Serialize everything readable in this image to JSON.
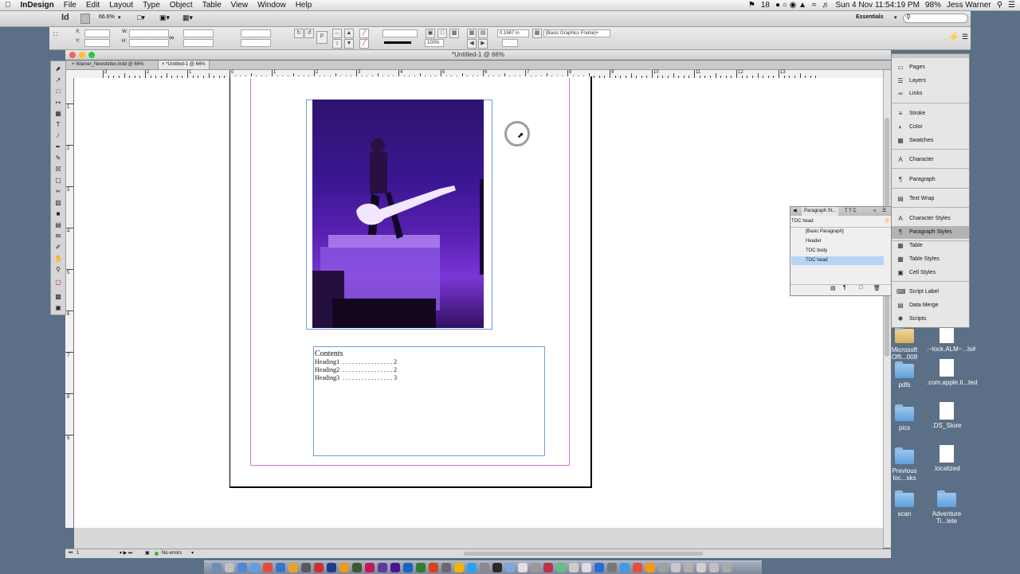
{
  "menubar": {
    "app": "InDesign",
    "items": [
      "File",
      "Edit",
      "Layout",
      "Type",
      "Object",
      "Table",
      "View",
      "Window",
      "Help"
    ],
    "right": {
      "flag_count": "18",
      "clock": "Sun 4 Nov  11:54:19 PM",
      "battery": "98%",
      "user": "Jess Warner"
    }
  },
  "appbar": {
    "logo": "Id",
    "zoom": "66.6%",
    "workspace": "Essentials",
    "search_placeholder": ""
  },
  "control": {
    "x_label": "X:",
    "y_label": "Y:",
    "w_label": "W:",
    "h_label": "H:",
    "stroke_weight": "0.1667 in",
    "scale_pct": "100%",
    "object_style": "[Basic Graphics Frame]+"
  },
  "document": {
    "window_title": "*Untitled-1 @ 66%",
    "tabs": [
      "Warner_Newsletter.indd @ 66%",
      "*Untitled-1 @ 66%"
    ]
  },
  "ruler_top_labels": [
    "3",
    "2",
    "1",
    "0",
    "1",
    "2",
    "3",
    "4",
    "5",
    "6",
    "7",
    "8",
    "9",
    "10",
    "11",
    "12",
    "13"
  ],
  "ruler_left_labels": [
    "1",
    "2",
    "3",
    "4",
    "5",
    "6",
    "7",
    "8",
    "9"
  ],
  "toc": {
    "heading": "Contents",
    "rows": [
      "Heading1  . . . . . . . . . . . . . . . . 2",
      "Heading2  . . . . . . . . . . . . . . . . 2",
      "Heading3  . . . . . . . . . . . . . . . . 3"
    ]
  },
  "status": {
    "page": "1",
    "errors": "No errors"
  },
  "panels": {
    "items": [
      {
        "label": "Pages",
        "icon": "pages-icon"
      },
      {
        "label": "Layers",
        "icon": "layers-icon"
      },
      {
        "label": "Links",
        "icon": "links-icon"
      },
      {
        "label": "Stroke",
        "icon": "stroke-icon"
      },
      {
        "label": "Color",
        "icon": "color-icon"
      },
      {
        "label": "Swatches",
        "icon": "swatches-icon"
      },
      {
        "label": "Character",
        "icon": "character-icon"
      },
      {
        "label": "Paragraph",
        "icon": "paragraph-icon"
      },
      {
        "label": "Text Wrap",
        "icon": "text-wrap-icon"
      },
      {
        "label": "Character Styles",
        "icon": "character-styles-icon"
      },
      {
        "label": "Paragraph Styles",
        "icon": "paragraph-styles-icon"
      },
      {
        "label": "Table",
        "icon": "table-icon"
      },
      {
        "label": "Table Styles",
        "icon": "table-styles-icon"
      },
      {
        "label": "Cell Styles",
        "icon": "cell-styles-icon"
      },
      {
        "label": "Script Label",
        "icon": "script-label-icon"
      },
      {
        "label": "Data Merge",
        "icon": "data-merge-icon"
      },
      {
        "label": "Scripts",
        "icon": "scripts-icon"
      }
    ]
  },
  "paragraph_styles": {
    "title": "Paragraph St...",
    "tabs": "T T C",
    "current": "TOC head",
    "styles": [
      "[Basic Paragraph]",
      "Header",
      "TOC body",
      "TOC head"
    ],
    "selected": "TOC head"
  },
  "desktop": {
    "icons": [
      {
        "label": "Microsoft Offi...008",
        "kind": "folder"
      },
      {
        "label": ".~lock.ALM~...ls#",
        "kind": "doc"
      },
      {
        "label": "pdfs",
        "kind": "folder"
      },
      {
        "label": ".com.apple.ti...ted",
        "kind": "doc"
      },
      {
        "label": "pics",
        "kind": "folder"
      },
      {
        "label": ".DS_Store",
        "kind": "doc"
      },
      {
        "label": "Previous loc...sks",
        "kind": "folder"
      },
      {
        "label": ".localized",
        "kind": "doc"
      },
      {
        "label": "scan",
        "kind": "folder"
      },
      {
        "label": "Adventure Ti...lete",
        "kind": "folder"
      }
    ]
  },
  "colors": {
    "selection": "#b7d4f7",
    "frame_edge": "#6ea0d8",
    "margin": "#d679c8",
    "photo_tint": "#5a21b4",
    "no_errors": "#36b536"
  }
}
